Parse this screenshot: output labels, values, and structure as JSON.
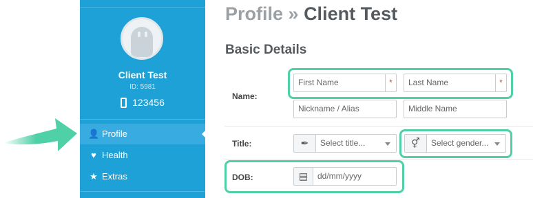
{
  "page": {
    "title_prefix": "Profile »",
    "title_main": "Client Test",
    "section": "Basic Details"
  },
  "sidebar": {
    "client_name": "Client Test",
    "client_id": "ID: 5981",
    "phone": "123456",
    "items": [
      {
        "label": "Profile",
        "icon": "user-icon",
        "active": true
      },
      {
        "label": "Health",
        "icon": "heart-icon",
        "active": false
      },
      {
        "label": "Extras",
        "icon": "star-icon",
        "active": false
      }
    ]
  },
  "form": {
    "name_label": "Name:",
    "first_name_placeholder": "First Name",
    "last_name_placeholder": "Last Name",
    "nickname_placeholder": "Nickname / Alias",
    "middle_name_placeholder": "Middle Name",
    "required_marker": "*",
    "title_label": "Title:",
    "title_select": "Select title...",
    "gender_select": "Select gender...",
    "dob_label": "DOB:",
    "dob_placeholder": "dd/mm/yyyy"
  },
  "colors": {
    "sidebar": "#1da1d6",
    "highlight": "#4fd0a7",
    "required": "#e0443c"
  }
}
